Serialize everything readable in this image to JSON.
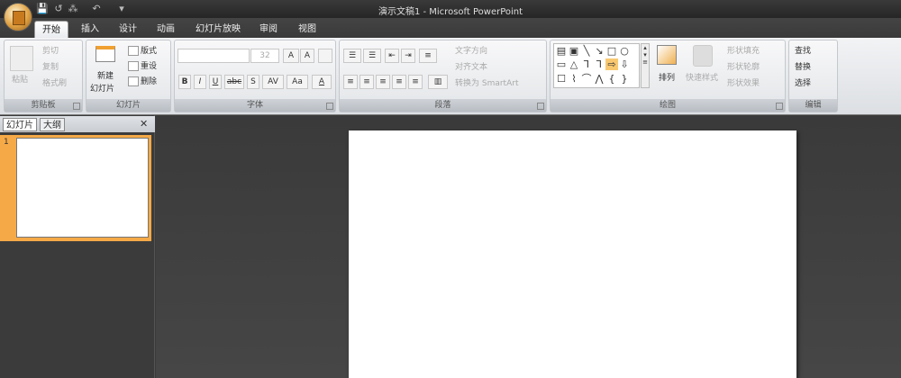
{
  "window": {
    "title": "演示文稿1 - Microsoft PowerPoint"
  },
  "qat": {
    "save": "💾",
    "undo": "↺",
    "find": "⁂",
    "redo": "↶",
    "more": "▾"
  },
  "tabs": [
    "开始",
    "插入",
    "设计",
    "动画",
    "幻灯片放映",
    "审阅",
    "视图"
  ],
  "groups": {
    "clipboard": {
      "label": "剪贴板",
      "paste": "粘贴",
      "cut": "剪切",
      "copy": "复制",
      "format_painter": "格式刷"
    },
    "slides": {
      "label": "幻灯片",
      "new_slide_1": "新建",
      "new_slide_2": "幻灯片",
      "layout": "版式",
      "reset": "重设",
      "delete": "删除"
    },
    "font": {
      "label": "字体",
      "font_name": "",
      "font_size": "32",
      "grow": "A",
      "shrink": "A",
      "bold": "B",
      "italic": "I",
      "underline": "U",
      "strike": "abc",
      "shadow": "S",
      "spacing": "AV",
      "case": "Aa",
      "color": "A"
    },
    "paragraph": {
      "label": "段落",
      "text_direction": "文字方向",
      "align_text": "对齐文本",
      "smartart": "转换为 SmartArt"
    },
    "drawing": {
      "label": "绘图",
      "arrange": "排列",
      "quick_styles": "快速样式",
      "fill": "形状填充",
      "outline": "形状轮廓",
      "effects": "形状效果",
      "shapes": [
        "▤",
        "▣",
        "╲",
        "↘",
        "□",
        "○",
        "▭",
        "△",
        "⅂",
        "⅂",
        "⇨",
        "⇩",
        "☐",
        "⌇",
        "⌒",
        "⋀",
        "{",
        "}"
      ]
    },
    "editing": {
      "label": "编辑",
      "find": "查找",
      "replace": "替换",
      "select": "选择"
    }
  },
  "left_pane": {
    "tab_slides": "幻灯片",
    "tab_outline": "大纲",
    "close": "✕",
    "slide_number": "1"
  }
}
